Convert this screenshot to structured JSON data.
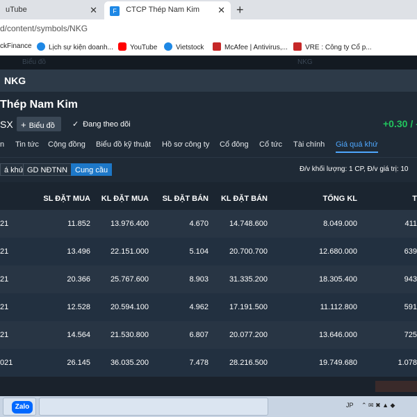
{
  "browser": {
    "tabs": [
      {
        "label": "uTube",
        "active": false
      },
      {
        "label": "CTCP Thép Nam Kim",
        "active": true
      }
    ],
    "url": "d/content/symbols/NKG",
    "bookmarks": [
      {
        "label": "ckFinance",
        "icon_color": "#1e88e5"
      },
      {
        "label": "Lịch sự kiện doanh...",
        "icon_color": "#1e88e5"
      },
      {
        "label": "YouTube",
        "icon_color": "#ff0000"
      },
      {
        "label": "Vietstock",
        "icon_color": "#1e88e5"
      },
      {
        "label": "McAfee | Antivirus,...",
        "icon_color": "#c62828"
      },
      {
        "label": "VRE : Công ty Cổ p...",
        "icon_color": "#c62828"
      }
    ]
  },
  "site": {
    "faint": [
      "Biểu đồ",
      "NKG"
    ]
  },
  "panel": {
    "title": "NKG"
  },
  "company": {
    "name": "Thép Nam Kim",
    "exchange": "SX",
    "chart_button": "Biểu đồ",
    "follow": "Đang theo dõi",
    "change": "+0.30 / -"
  },
  "nav": [
    "n",
    "Tin tức",
    "Cộng đồng",
    "Biểu đồ kỹ thuật",
    "Hồ sơ công ty",
    "Cổ đông",
    "Cổ tức",
    "Tài chính",
    "Giá quá khứ"
  ],
  "nav_active": "Giá quá khứ",
  "subtabs": [
    {
      "label": "á khứ",
      "active": false
    },
    {
      "label": "GD NĐTNN",
      "active": false
    },
    {
      "label": "Cung cầu",
      "active": true
    }
  ],
  "unit_note": "Đ/v khối lượng: 1 CP, Đ/v giá trị: 10",
  "table": {
    "columns": [
      "SL ĐẶT MUA",
      "KL ĐẶT MUA",
      "SL ĐẶT BÁN",
      "KL ĐẶT BÁN",
      "TỔNG KL",
      "T"
    ],
    "rows": [
      [
        "21",
        "11.852",
        "13.976.400",
        "4.670",
        "14.748.600",
        "8.049.000",
        "411"
      ],
      [
        "21",
        "13.496",
        "22.151.000",
        "5.104",
        "20.700.700",
        "12.680.000",
        "639"
      ],
      [
        "21",
        "20.366",
        "25.767.600",
        "8.903",
        "31.335.200",
        "18.305.400",
        "943"
      ],
      [
        "21",
        "12.528",
        "20.594.100",
        "4.962",
        "17.191.500",
        "11.112.800",
        "591"
      ],
      [
        "21",
        "14.564",
        "21.530.800",
        "6.807",
        "20.077.200",
        "13.646.000",
        "725"
      ],
      [
        "021",
        "26.145",
        "36.035.200",
        "7.478",
        "28.216.500",
        "19.749.680",
        "1.078"
      ]
    ]
  },
  "taskbar": {
    "app": "Zalo",
    "tray_lang": "JP"
  }
}
